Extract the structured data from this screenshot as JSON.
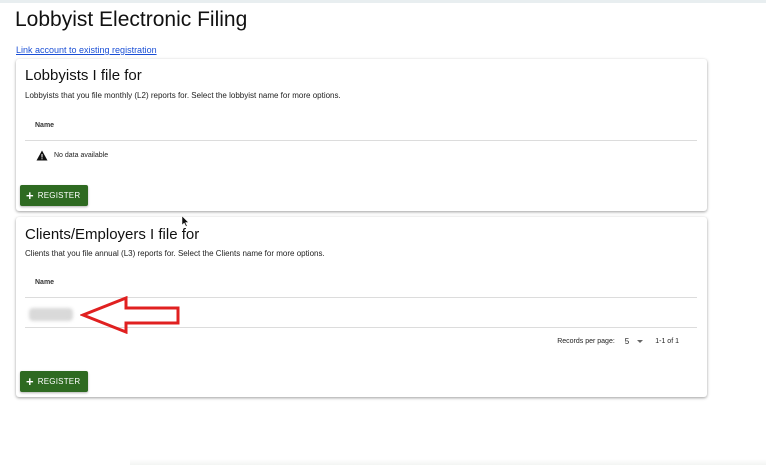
{
  "page": {
    "title": "Lobbyist Electronic Filing",
    "link_account": "Link account to existing registration"
  },
  "lobbyists_card": {
    "title": "Lobbyists I file for",
    "description": "Lobbyists that you file monthly (L2) reports for. Select the lobbyist name for more options.",
    "column_name": "Name",
    "empty_message": "No data available",
    "register_label": "REGISTER"
  },
  "clients_card": {
    "title": "Clients/Employers I file for",
    "description": "Clients that you file annual (L3) reports for. Select the Clients name for more options.",
    "column_name": "Name",
    "register_label": "REGISTER",
    "records_per_page_label": "Records per page:",
    "records_per_page_value": "5",
    "range_text": "1-1 of 1"
  },
  "colors": {
    "brand_green": "#2e6a21",
    "link_blue": "#1a4fd6",
    "annotation_red": "#e02020"
  },
  "icons": [
    "plus-icon",
    "warning-icon",
    "caret-down-icon",
    "mouse-cursor-icon",
    "red-arrow-annotation"
  ]
}
